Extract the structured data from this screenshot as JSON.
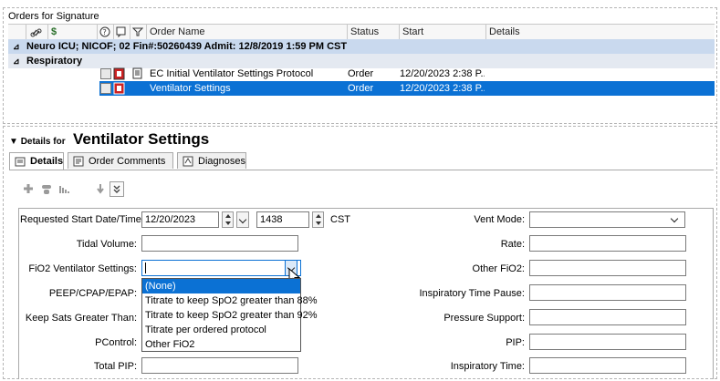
{
  "orders_panel": {
    "title": "Orders for Signature",
    "columns": [
      "Order Name",
      "Status",
      "Start",
      "Details"
    ],
    "encounter": "Neuro ICU; NICOF; 02  Fin#:50260439  Admit: 12/8/2019 1:59 PM CST",
    "group": "Respiratory",
    "rows": [
      {
        "name": "EC Initial Ventilator Settings Protocol",
        "status": "Order",
        "start": "12/20/2023 2:38 P...",
        "details": ""
      },
      {
        "name": "Ventilator Settings",
        "status": "Order",
        "start": "12/20/2023 2:38 P...",
        "details": ""
      }
    ]
  },
  "details": {
    "for_label": "Details for",
    "title": "Ventilator Settings",
    "tabs": [
      "Details",
      "Order Comments",
      "Diagnoses"
    ]
  },
  "form": {
    "requested_start_label": "Requested Start Date/Time:",
    "date_value": "12/20/2023",
    "time_value": "1438",
    "tz": "CST",
    "tidal_volume_label": "Tidal Volume:",
    "fio2_label": "FiO2 Ventilator Settings:",
    "fio2_value": "",
    "peep_label": "PEEP/CPAP/EPAP:",
    "keep_sats_label": "Keep Sats Greater Than:",
    "pcontrol_label": "PControl:",
    "total_pip_label": "Total PIP:",
    "vent_mode_label": "Vent Mode:",
    "rate_label": "Rate:",
    "other_fio2_label": "Other FiO2:",
    "insp_pause_label": "Inspiratory Time Pause:",
    "pressure_support_label": "Pressure Support:",
    "pip_label": "PIP:",
    "insp_time_label": "Inspiratory Time:"
  },
  "fio2_dropdown": {
    "options": [
      "(None)",
      "Titrate to keep SpO2 greater than 88%",
      "Titrate to keep SpO2 greater than 92%",
      "Titrate per ordered protocol",
      "Other FiO2"
    ],
    "selected": "(None)"
  },
  "colors": {
    "selection": "#0b71d4",
    "encounter_bg": "#c9d9ee",
    "group_bg": "#e4e9f1"
  }
}
